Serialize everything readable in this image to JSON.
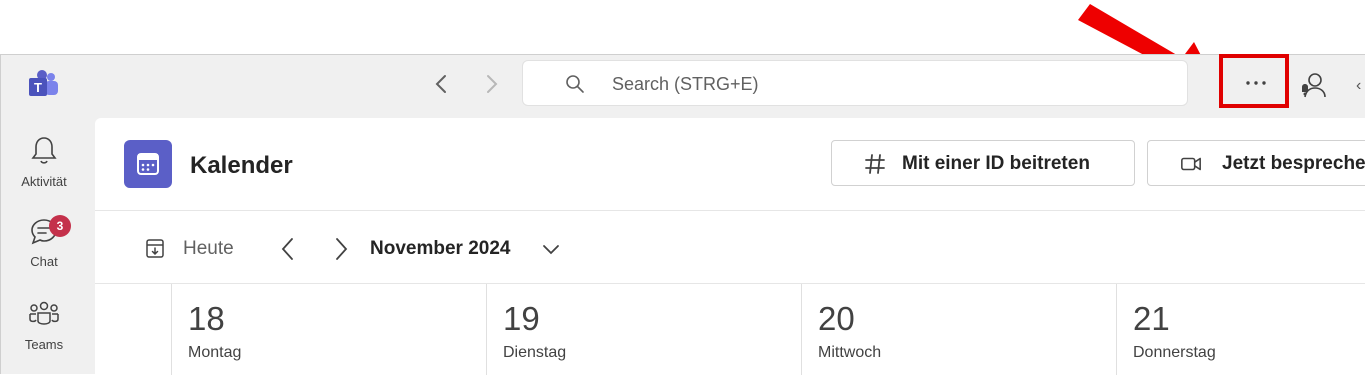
{
  "search": {
    "placeholder": "Search (STRG+E)"
  },
  "sidebar": {
    "items": [
      {
        "label": "Aktivität",
        "icon": "bell-icon"
      },
      {
        "label": "Chat",
        "icon": "chat-icon",
        "badge": "3"
      },
      {
        "label": "Teams",
        "icon": "teams-icon"
      }
    ]
  },
  "header": {
    "title": "Kalender",
    "join_label": "Mit einer ID beitreten",
    "meet_label": "Jetzt bespreche"
  },
  "toolbar": {
    "today_label": "Heute",
    "month_label": "November 2024"
  },
  "days": [
    {
      "num": "18",
      "name": "Montag"
    },
    {
      "num": "19",
      "name": "Dienstag"
    },
    {
      "num": "20",
      "name": "Mittwoch"
    },
    {
      "num": "21",
      "name": "Donnerstag"
    }
  ],
  "colors": {
    "accent": "#5b5fc7",
    "badge": "#c4314b",
    "highlight": "#e00000"
  }
}
